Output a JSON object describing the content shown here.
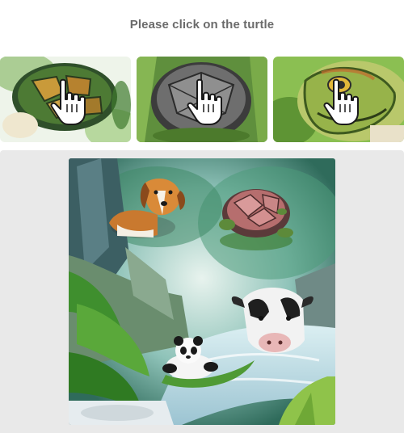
{
  "instruction": {
    "text": "Please click on the turtle"
  },
  "examples": [
    {
      "subject": "turtle-shell-closeup",
      "cursor_icon": "hand-pointer-icon"
    },
    {
      "subject": "gray-turtle-shell",
      "cursor_icon": "hand-pointer-icon"
    },
    {
      "subject": "turtle-head-closeup",
      "cursor_icon": "hand-pointer-icon"
    }
  ],
  "scene": {
    "style": "watercolor jungle",
    "animals": [
      "dog",
      "turtle",
      "cow",
      "panda"
    ]
  },
  "colors": {
    "instruction_text": "#6b6b6b",
    "panel_background": "#e9e9e9",
    "page_background": "#ffffff"
  }
}
